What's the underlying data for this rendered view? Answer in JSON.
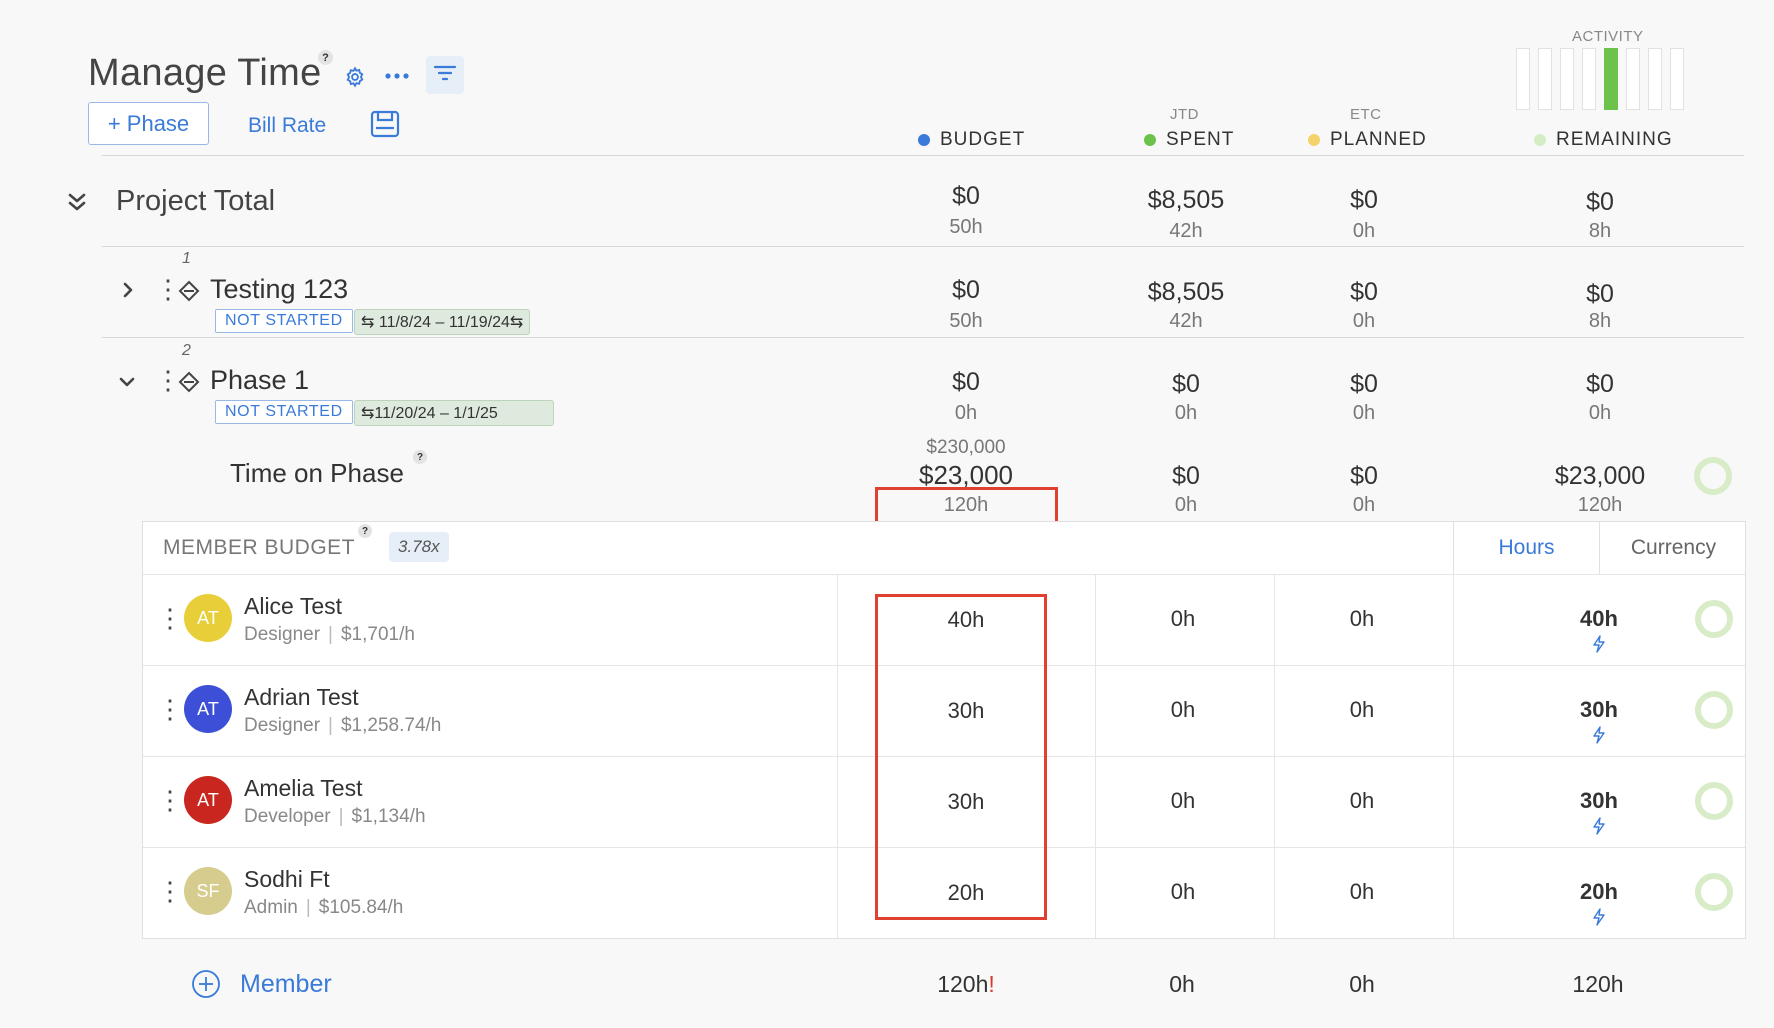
{
  "header": {
    "title": "Manage Time",
    "help_mark": "?",
    "add_phase_label": "+ Phase",
    "bill_rate_label": "Bill Rate",
    "activity_label": "ACTIVITY"
  },
  "columns": {
    "budget": {
      "label": "BUDGET",
      "sub": "",
      "color": "#3a7ad9"
    },
    "spent": {
      "label": "SPENT",
      "sub": "JTD",
      "color": "#6cc24a"
    },
    "planned": {
      "label": "PLANNED",
      "sub": "ETC",
      "color": "#f5d36b"
    },
    "remaining": {
      "label": "REMAINING",
      "sub": "",
      "color": "#d5edc2"
    }
  },
  "project_total": {
    "label": "Project Total",
    "budget": "$0",
    "budget_hours": "50h",
    "spent": "$8,505",
    "spent_hours": "42h",
    "planned": "$0",
    "planned_hours": "0h",
    "remaining": "$0",
    "remaining_hours": "8h"
  },
  "phases": [
    {
      "index": "1",
      "name": "Testing 123",
      "status": "NOT STARTED",
      "dates": "⇆ 11/8/24  – 11/19/24⇆",
      "budget": "$0",
      "budget_hours": "50h",
      "spent": "$8,505",
      "spent_hours": "42h",
      "planned": "$0",
      "planned_hours": "0h",
      "remaining": "$0",
      "remaining_hours": "8h"
    },
    {
      "index": "2",
      "name": "Phase 1",
      "status": "NOT STARTED",
      "dates": "⇆11/20/24 –   1/1/25",
      "budget": "$0",
      "budget_hours": "0h",
      "spent": "$0",
      "spent_hours": "0h",
      "planned": "$0",
      "planned_hours": "0h",
      "remaining": "$0",
      "remaining_hours": "0h"
    }
  ],
  "time_on_phase": {
    "label": "Time on Phase",
    "budget_top": "$230,000",
    "budget": "$23,000",
    "budget_hours": "120h",
    "spent": "$0",
    "spent_hours": "0h",
    "planned": "$0",
    "planned_hours": "0h",
    "remaining": "$23,000",
    "remaining_hours": "120h"
  },
  "member_budget": {
    "label": "MEMBER BUDGET",
    "multiplier": "3.78x",
    "toggle_hours": "Hours",
    "toggle_currency": "Currency",
    "members": [
      {
        "initials": "AT",
        "name": "Alice Test",
        "role": "Designer",
        "rate": "$1,701/h",
        "avatar_color": "#e8cf3a",
        "budget": "40h",
        "spent": "0h",
        "planned": "0h",
        "remaining": "40h"
      },
      {
        "initials": "AT",
        "name": "Adrian Test",
        "role": "Designer",
        "rate": "$1,258.74/h",
        "avatar_color": "#3d4fd6",
        "budget": "30h",
        "spent": "0h",
        "planned": "0h",
        "remaining": "30h"
      },
      {
        "initials": "AT",
        "name": "Amelia Test",
        "role": "Developer",
        "rate": "$1,134/h",
        "avatar_color": "#c8261e",
        "budget": "30h",
        "spent": "0h",
        "planned": "0h",
        "remaining": "30h"
      },
      {
        "initials": "SF",
        "name": "Sodhi Ft",
        "role": "Admin",
        "rate": "$105.84/h",
        "avatar_color": "#d6cc8e",
        "budget": "20h",
        "spent": "0h",
        "planned": "0h",
        "remaining": "20h"
      }
    ],
    "footer": {
      "add_member_label": "Member",
      "budget": "120h",
      "budget_warning": "!",
      "spent": "0h",
      "planned": "0h",
      "remaining": "120h"
    }
  },
  "activity_bars": 8,
  "activity_active_index": 4
}
